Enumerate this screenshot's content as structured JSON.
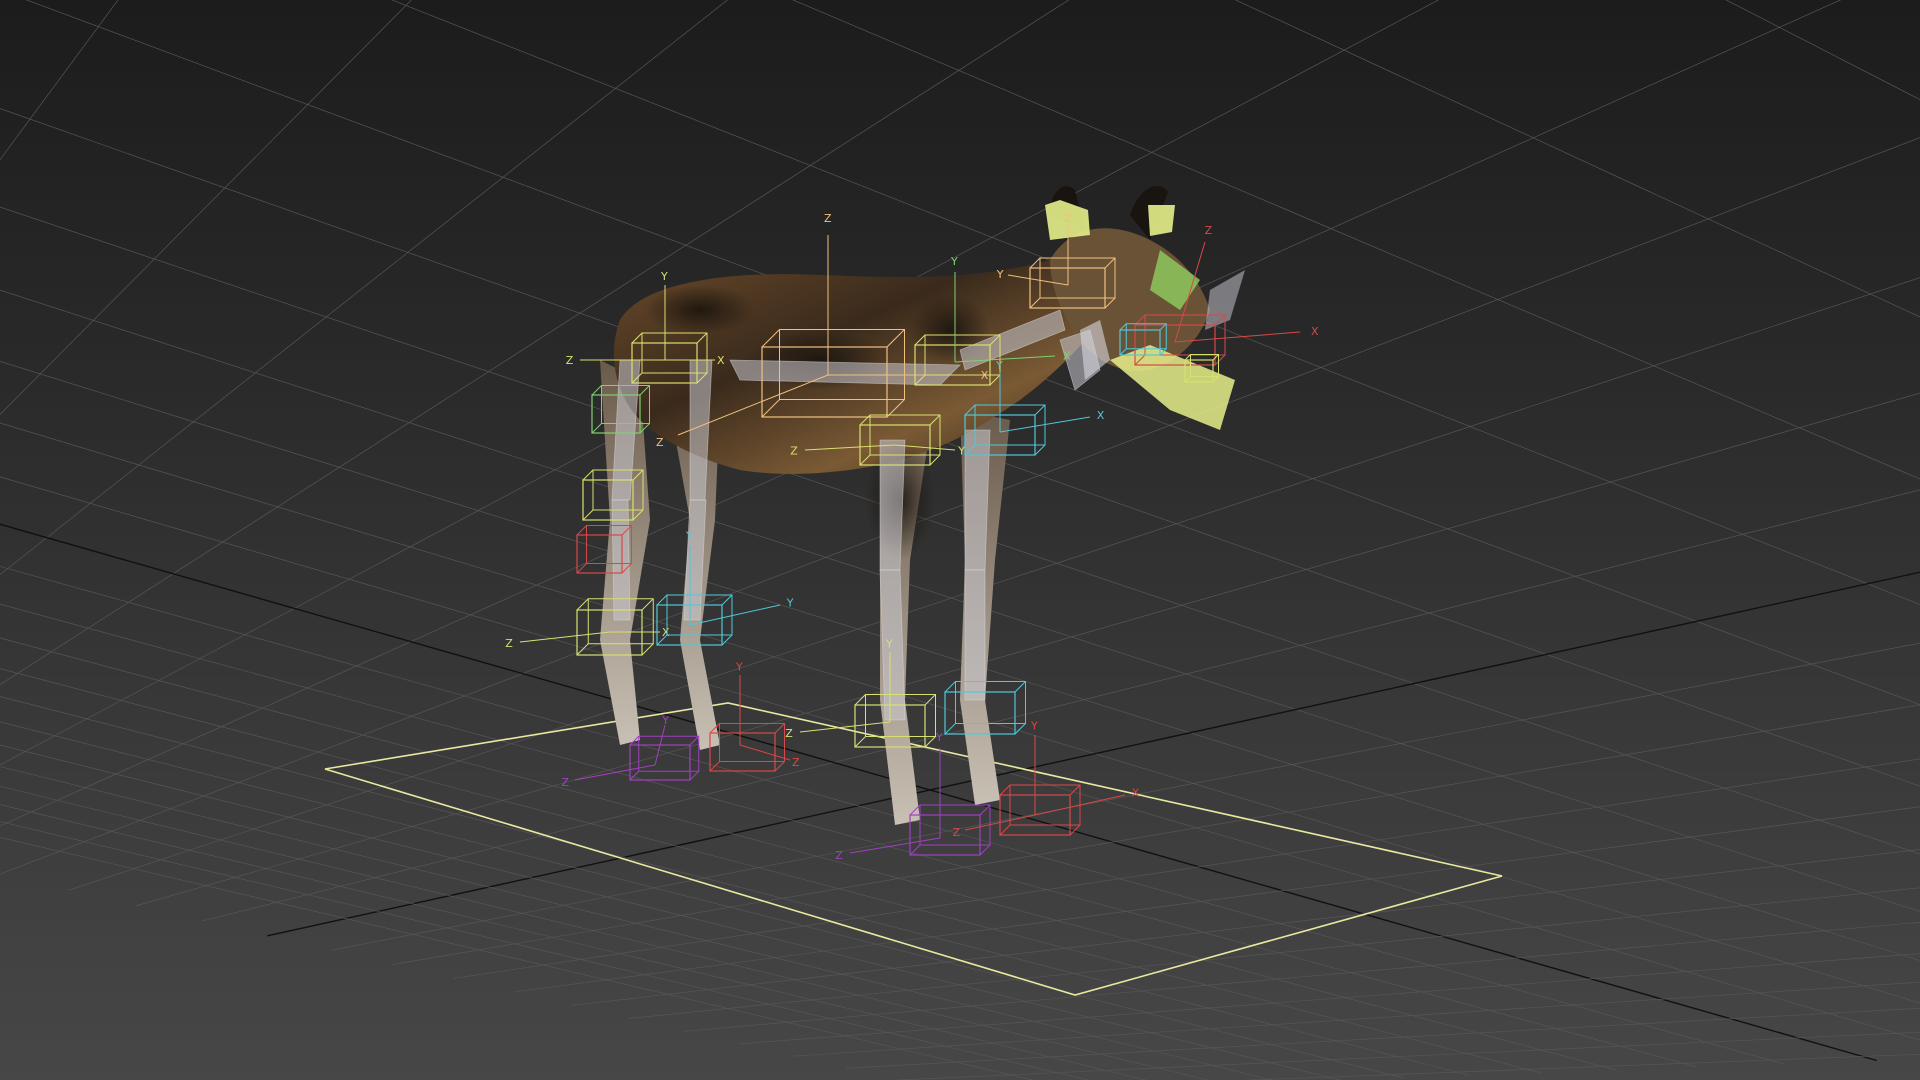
{
  "viewport": {
    "background_top": "#1c1c1c",
    "background_bottom": "#474747",
    "grid_color": "#565656",
    "grid_major_color": "#111111",
    "selection_box_color": "#e8e8a0"
  },
  "rig": {
    "colors": {
      "yellow": "#d8e070",
      "orange": "#f0c080",
      "green": "#80d070",
      "cyan": "#50c8d8",
      "red": "#d84848",
      "purple": "#a040c0",
      "bone": "#c8c8d0"
    },
    "axis_labels": {
      "x": "X",
      "y": "Y",
      "z": "Z"
    }
  },
  "model": {
    "name_icon": "wild-dog-model",
    "coat_colors": [
      "#5a4028",
      "#2a2018",
      "#8a6a40",
      "#b8b0a0"
    ]
  }
}
